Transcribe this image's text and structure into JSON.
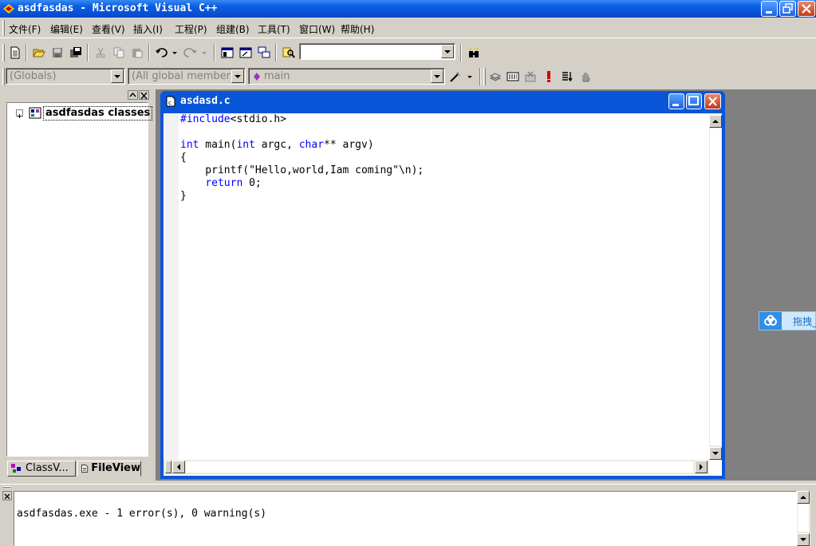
{
  "window": {
    "title": "asdfasdas - Microsoft Visual C++"
  },
  "menu": [
    {
      "label": "文件(F)"
    },
    {
      "label": "编辑(E)"
    },
    {
      "label": "查看(V)"
    },
    {
      "label": "插入(I)"
    },
    {
      "label": "工程(P)"
    },
    {
      "label": "组建(B)"
    },
    {
      "label": "工具(T)"
    },
    {
      "label": "窗口(W)"
    },
    {
      "label": "帮助(H)"
    }
  ],
  "toolbar": {
    "find_combo_value": ""
  },
  "wizardbar": {
    "scope": "(Globals)",
    "members": "(All global members",
    "function": "main"
  },
  "workspace": {
    "tree_root": "asdfasdas classes",
    "tabs": [
      {
        "label": "ClassV..."
      },
      {
        "label": "FileView"
      }
    ]
  },
  "editor": {
    "file_title": "asdasd.c",
    "lines": [
      {
        "parts": [
          {
            "t": "#include",
            "kw": true
          },
          {
            "t": "<stdio.h>",
            "kw": false
          }
        ]
      },
      {
        "parts": []
      },
      {
        "parts": [
          {
            "t": "int",
            "kw": true
          },
          {
            "t": " main(",
            "kw": false
          },
          {
            "t": "int",
            "kw": true
          },
          {
            "t": " argc, ",
            "kw": false
          },
          {
            "t": "char",
            "kw": true
          },
          {
            "t": "** argv)",
            "kw": false
          }
        ]
      },
      {
        "parts": [
          {
            "t": "{",
            "kw": false
          }
        ]
      },
      {
        "parts": [
          {
            "t": "    printf(\"Hello,world,Iam coming\"\\n);",
            "kw": false
          }
        ]
      },
      {
        "parts": [
          {
            "t": "    ",
            "kw": false
          },
          {
            "t": "return",
            "kw": true
          },
          {
            "t": " 0;",
            "kw": false
          }
        ]
      },
      {
        "parts": [
          {
            "t": "}",
            "kw": false
          }
        ]
      }
    ]
  },
  "floating_widget": {
    "label": "拖拽_"
  },
  "output": {
    "text": "asdfasdas.exe - 1 error(s), 0 warning(s)"
  },
  "colors": {
    "titlebar": "#0b5fe6",
    "keyword": "#0000ff",
    "mdi_background": "#808080"
  }
}
